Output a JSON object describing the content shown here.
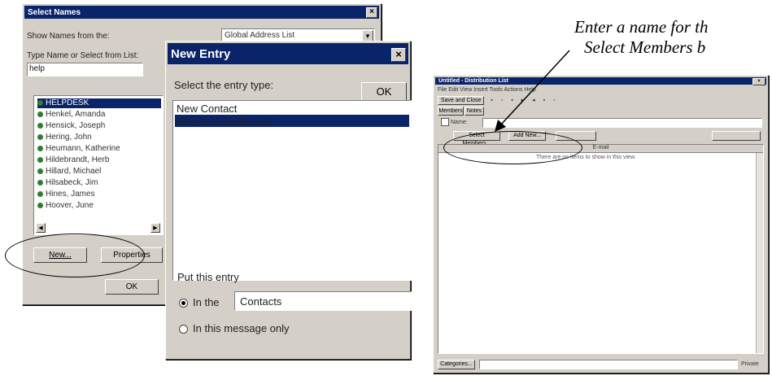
{
  "caption": {
    "line1": "Enter a name for th",
    "line2": "Select Members b"
  },
  "select_names": {
    "title": "Select Names",
    "show_names_label": "Show Names from the:",
    "address_book": "Global Address List",
    "type_name_label": "Type Name or Select from List:",
    "typed_value": "help",
    "names": [
      "HELPDESK",
      "Henkel, Amanda",
      "Hensick, Joseph",
      "Hering, John",
      "Heumann, Katherine",
      "Hildebrandt, Herb",
      "Hillard, Michael",
      "Hilsabeck, Jim",
      "Hines, James",
      "Hoover, June"
    ],
    "new_button": "New...",
    "properties_button": "Properties",
    "ok_button": "OK"
  },
  "new_entry": {
    "title": "New Entry",
    "select_type_label": "Select the entry type:",
    "types": [
      "New Contact",
      "New Distribution List"
    ],
    "ok_button": "OK",
    "put_entry_label": "Put this entry",
    "in_the_label": "In the",
    "folder": "Contacts",
    "in_message_label": "In this message only"
  },
  "dist_list": {
    "title": "Untitled - Distribution List",
    "menu": "File  Edit  View  Insert  Tools  Actions  Help",
    "save_close": "Save and Close",
    "tab_members": "Members",
    "tab_notes": "Notes",
    "name_label": "Name:",
    "select_members_button": "Select Members...",
    "add_new_button": "Add New...",
    "email_header": "E-mail",
    "empty_msg": "There are no items to show in this view.",
    "categories_button": "Categories...",
    "private_label": "Private"
  }
}
